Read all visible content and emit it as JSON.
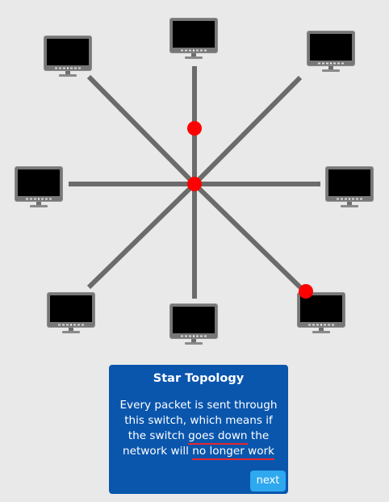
{
  "topology": {
    "computer_icon": "computer-monitor-icon",
    "switch_icon": "switch-node-icon",
    "packet_icon": "packet-dot-icon",
    "computer_count": 8,
    "packet_count": 2,
    "colors": {
      "background": "#e9e9e9",
      "cable": "#6b6b6b",
      "packet": "#ff0000",
      "monitor_frame": "#808080",
      "monitor_screen": "#000000"
    }
  },
  "info_panel": {
    "title": "Star Topology",
    "body_line1": "Every packet is sent through",
    "body_line2": "this switch, which means if",
    "body_line3_a": "the switch ",
    "body_line3_b": "goes down",
    "body_line3_c": " the",
    "body_line4_a": "network will ",
    "body_line4_b": "no longer work",
    "next_label": "next",
    "colors": {
      "panel": "#0a56ad",
      "highlight_underline": "#e8262b",
      "next_button": "#2ea8ef"
    }
  }
}
